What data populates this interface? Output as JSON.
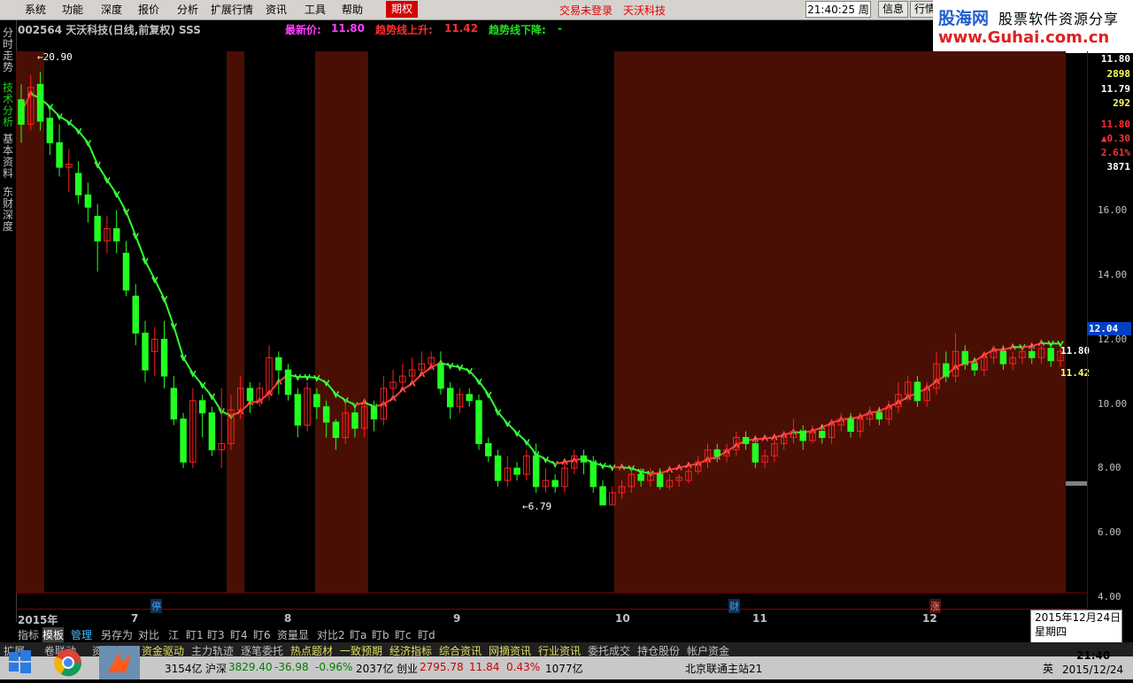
{
  "menu": [
    "系统",
    "功能",
    "深度",
    "报价",
    "分析",
    "扩展行情",
    "资讯",
    "工具",
    "帮助"
  ],
  "menu_special": "期权",
  "menu_status": [
    "交易未登录",
    "天沃科技"
  ],
  "clock": "21:40:25 周四",
  "toolbar_buttons": [
    "信息",
    "行情"
  ],
  "logo": {
    "line1a": "股海网",
    "line1b": "股票软件资源分享",
    "line2": "www.Guhai.com.cn"
  },
  "left_tabs": [
    "分时走势",
    "技术分析",
    "基本资料",
    "东财深度"
  ],
  "header": {
    "code_name": "002564 天沃科技(日线,前复权) SSS",
    "last_label": "最新价:",
    "last_value": "11.80",
    "up_label": "趋势线上升:",
    "up_value": "11.42",
    "down_label": "趋势线下降:",
    "down_value": "-"
  },
  "chart_labels": {
    "high": "20.90",
    "low": "6.79",
    "last_right": "11.80",
    "up_right": "11.42"
  },
  "right_panel": {
    "v1": "11.80",
    "v2": "2898",
    "v3": "11.79",
    "v4": "292",
    "v5": "11.80",
    "v6": "0.30",
    "v7": "2.61%",
    "v8": "3871",
    "price_tag": "12.04"
  },
  "y_axis": [
    "16.00",
    "14.00",
    "12.00",
    "10.00",
    "8.00",
    "6.00",
    "4.00"
  ],
  "date_axis": {
    "year": "2015年",
    "months": [
      "7",
      "8",
      "9",
      "10",
      "11",
      "12"
    ],
    "markers": [
      "停",
      "财",
      "涨"
    ]
  },
  "date_box": {
    "date": "2015年12月24日",
    "weekday": "星期四"
  },
  "indicator_tabs": [
    "指标",
    "模板",
    "管理",
    "另存为",
    "对比",
    "江",
    "盯1",
    "盯3",
    "盯4",
    "盯6",
    "资量显",
    "对比2",
    "盯a",
    "盯b",
    "盯c",
    "盯d"
  ],
  "info_bar": [
    "扩展",
    "卷联动",
    "资金流",
    "资金驱动",
    "主力轨迹",
    "逐笔委托",
    "热点题材",
    "一致预期",
    "经济指标",
    "综合资讯",
    "网摘资讯",
    "行业资讯",
    "委托成交",
    "持仓股份",
    "帐户资金"
  ],
  "status_bar": {
    "items": [
      "3154亿",
      "沪深",
      "3829.40",
      "-36.98",
      "-0.96%",
      "2037亿",
      "创业",
      "2795.78",
      "11.84",
      "0.43%",
      "1077亿",
      "北京联通主站21"
    ],
    "tray_lang": "英",
    "tray_time": "21:40",
    "tray_date": "2015/12/24"
  },
  "colors": {
    "up": "#ff2020",
    "down": "#22ff22",
    "band": "#4a0f04",
    "axis": "#800000"
  },
  "chart_data": {
    "type": "candlestick",
    "title": "002564 天沃科技(日线,前复权) SSS",
    "y_range": [
      4.0,
      21.0
    ],
    "candles": [
      [
        20.0,
        19.2,
        20.5,
        18.6
      ],
      [
        19.2,
        20.4,
        20.8,
        19.0
      ],
      [
        20.5,
        19.3,
        20.9,
        19.0
      ],
      [
        19.4,
        18.6,
        19.8,
        18.2
      ],
      [
        18.6,
        17.8,
        19.2,
        17.5
      ],
      [
        17.8,
        17.9,
        18.4,
        17.0
      ],
      [
        17.6,
        16.9,
        18.0,
        16.6
      ],
      [
        16.9,
        16.5,
        17.3,
        16.0
      ],
      [
        16.2,
        15.4,
        16.6,
        14.4
      ],
      [
        15.4,
        15.8,
        16.2,
        15.0
      ],
      [
        15.8,
        15.4,
        16.4,
        15.0
      ],
      [
        15.0,
        13.8,
        15.4,
        13.6
      ],
      [
        13.6,
        12.4,
        14.0,
        12.0
      ],
      [
        12.4,
        11.2,
        12.8,
        10.8
      ],
      [
        11.8,
        12.2,
        12.6,
        11.0
      ],
      [
        12.2,
        11.0,
        12.8,
        10.6
      ],
      [
        10.6,
        9.6,
        11.0,
        9.4
      ],
      [
        9.6,
        8.2,
        9.8,
        8.0
      ],
      [
        8.2,
        10.2,
        10.6,
        8.0
      ],
      [
        10.2,
        9.8,
        10.4,
        9.0
      ],
      [
        9.8,
        8.6,
        10.0,
        8.4
      ],
      [
        8.6,
        8.8,
        10.6,
        8.0
      ],
      [
        8.8,
        9.9,
        10.4,
        8.6
      ],
      [
        9.9,
        10.6,
        11.0,
        9.6
      ],
      [
        10.6,
        10.2,
        10.8,
        9.8
      ],
      [
        10.2,
        10.6,
        10.8,
        10.0
      ],
      [
        10.4,
        11.6,
        12.0,
        10.2
      ],
      [
        11.6,
        11.2,
        11.8,
        10.4
      ],
      [
        11.2,
        10.4,
        11.4,
        10.2
      ],
      [
        10.4,
        9.4,
        10.6,
        9.0
      ],
      [
        9.4,
        10.6,
        10.8,
        9.2
      ],
      [
        10.4,
        10.0,
        10.6,
        9.6
      ],
      [
        10.0,
        9.5,
        10.2,
        9.0
      ],
      [
        9.5,
        9.0,
        9.6,
        8.6
      ],
      [
        9.0,
        9.8,
        10.2,
        8.8
      ],
      [
        9.8,
        9.3,
        10.0,
        9.0
      ],
      [
        9.3,
        10.0,
        10.2,
        9.0
      ],
      [
        10.0,
        9.6,
        10.2,
        9.2
      ],
      [
        9.6,
        10.6,
        11.0,
        9.4
      ],
      [
        10.6,
        10.8,
        11.2,
        10.2
      ],
      [
        10.8,
        11.0,
        11.4,
        10.6
      ],
      [
        11.0,
        11.2,
        11.6,
        10.8
      ],
      [
        11.2,
        11.4,
        11.8,
        11.0
      ],
      [
        11.4,
        11.6,
        11.8,
        11.2
      ],
      [
        11.4,
        10.6,
        11.8,
        10.4
      ],
      [
        10.6,
        10.0,
        10.8,
        9.6
      ],
      [
        10.0,
        10.4,
        10.6,
        9.8
      ],
      [
        10.4,
        10.2,
        10.6,
        10.0
      ],
      [
        10.2,
        8.8,
        10.4,
        8.6
      ],
      [
        8.8,
        8.4,
        9.0,
        8.2
      ],
      [
        8.4,
        7.6,
        8.6,
        7.4
      ],
      [
        7.6,
        8.0,
        8.4,
        7.4
      ],
      [
        8.0,
        7.8,
        8.2,
        7.6
      ],
      [
        7.8,
        8.4,
        8.6,
        7.6
      ],
      [
        8.4,
        7.4,
        8.8,
        7.2
      ],
      [
        7.4,
        7.6,
        8.0,
        7.2
      ],
      [
        7.6,
        7.4,
        7.8,
        7.2
      ],
      [
        7.4,
        8.0,
        8.2,
        7.2
      ],
      [
        8.0,
        8.4,
        8.6,
        7.8
      ],
      [
        8.4,
        8.2,
        8.6,
        7.8
      ],
      [
        8.2,
        7.4,
        8.4,
        7.2
      ],
      [
        7.4,
        6.8,
        7.6,
        6.8
      ],
      [
        6.8,
        7.2,
        7.4,
        6.8
      ],
      [
        7.2,
        7.4,
        7.6,
        7.0
      ],
      [
        7.4,
        7.8,
        8.0,
        7.2
      ],
      [
        7.8,
        7.6,
        8.0,
        7.4
      ],
      [
        7.6,
        7.8,
        8.0,
        7.4
      ],
      [
        7.8,
        7.4,
        8.0,
        7.3
      ],
      [
        7.4,
        7.6,
        7.8,
        7.3
      ],
      [
        7.6,
        7.7,
        7.8,
        7.4
      ],
      [
        7.6,
        7.9,
        8.0,
        7.5
      ],
      [
        7.9,
        8.2,
        8.4,
        7.8
      ],
      [
        8.2,
        8.6,
        8.8,
        8.0
      ],
      [
        8.6,
        8.4,
        8.8,
        8.2
      ],
      [
        8.4,
        8.6,
        8.8,
        8.2
      ],
      [
        8.6,
        9.0,
        9.2,
        8.4
      ],
      [
        9.0,
        8.8,
        9.2,
        8.6
      ],
      [
        8.8,
        8.2,
        9.0,
        8.0
      ],
      [
        8.2,
        8.4,
        8.6,
        8.0
      ],
      [
        8.4,
        8.8,
        9.0,
        8.2
      ],
      [
        8.8,
        9.0,
        9.2,
        8.6
      ],
      [
        9.0,
        9.2,
        9.6,
        8.8
      ],
      [
        9.2,
        8.9,
        9.4,
        8.6
      ],
      [
        8.9,
        9.2,
        9.4,
        8.8
      ],
      [
        9.2,
        9.0,
        9.4,
        8.8
      ],
      [
        9.0,
        9.4,
        9.6,
        8.8
      ],
      [
        9.4,
        9.6,
        9.8,
        9.2
      ],
      [
        9.6,
        9.2,
        9.8,
        9.0
      ],
      [
        9.2,
        9.6,
        9.8,
        9.0
      ],
      [
        9.6,
        9.8,
        10.0,
        9.4
      ],
      [
        9.8,
        9.6,
        10.0,
        9.4
      ],
      [
        9.6,
        10.0,
        10.2,
        9.4
      ],
      [
        10.0,
        10.4,
        10.8,
        9.8
      ],
      [
        10.4,
        10.8,
        11.0,
        10.2
      ],
      [
        10.8,
        10.2,
        11.0,
        10.0
      ],
      [
        10.2,
        10.6,
        10.8,
        10.0
      ],
      [
        10.6,
        11.4,
        11.8,
        10.4
      ],
      [
        11.4,
        11.0,
        11.8,
        10.8
      ],
      [
        11.0,
        11.8,
        12.4,
        10.8
      ],
      [
        11.8,
        11.4,
        12.0,
        11.2
      ],
      [
        11.4,
        11.2,
        11.6,
        11.0
      ],
      [
        11.2,
        11.6,
        11.8,
        11.0
      ],
      [
        11.6,
        11.8,
        12.0,
        11.4
      ],
      [
        11.8,
        11.4,
        12.0,
        11.2
      ],
      [
        11.4,
        11.6,
        11.8,
        11.2
      ],
      [
        11.6,
        11.8,
        12.0,
        11.4
      ],
      [
        11.8,
        11.6,
        12.0,
        11.4
      ],
      [
        11.6,
        11.9,
        12.0,
        11.4
      ],
      [
        11.9,
        11.5,
        12.0,
        11.3
      ],
      [
        11.5,
        11.8,
        11.9,
        11.3
      ]
    ],
    "trend_up_start": 0,
    "trend_split": [
      4,
      33,
      39,
      59,
      69
    ]
  }
}
